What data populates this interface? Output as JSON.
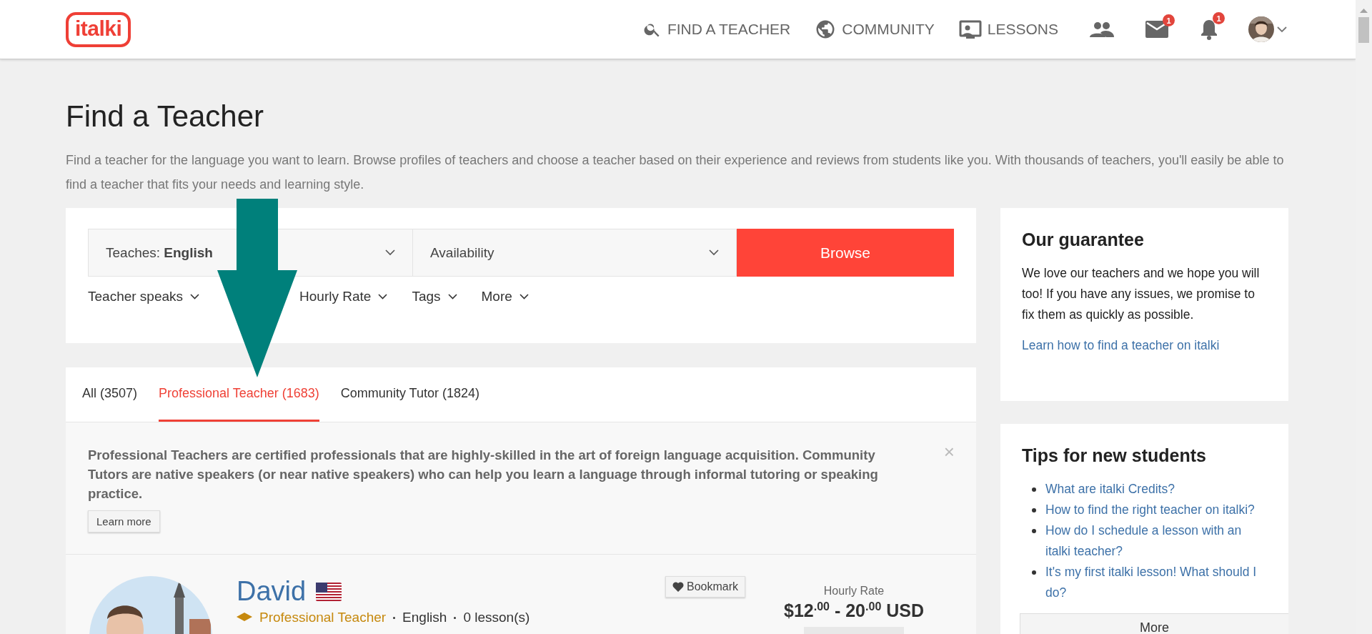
{
  "header": {
    "logo": "italki",
    "nav": [
      {
        "label": "FIND A TEACHER",
        "kind": "search"
      },
      {
        "label": "COMMUNITY",
        "kind": "globe"
      },
      {
        "label": "LESSONS",
        "kind": "lessons"
      }
    ],
    "icons": [
      {
        "kind": "people"
      },
      {
        "kind": "mail",
        "badge": "1"
      },
      {
        "kind": "bell",
        "badge": "1"
      }
    ]
  },
  "page": {
    "title": "Find a Teacher",
    "description": "Find a teacher for the language you want to learn. Browse profiles of teachers and choose a teacher based on their experience and reviews from students like you. With thousands of teachers, you'll easily be able to find a teacher that fits your needs and learning style."
  },
  "search": {
    "teaches": "Teaches: **English**",
    "availability": "Availability",
    "browse": "Browse",
    "filters": [
      "Teacher speaks",
      "Hourly Rate",
      "Tags",
      "More"
    ]
  },
  "tabs": [
    {
      "label": "All (3507)",
      "selected": false
    },
    {
      "label": "Professional Teacher (1683)",
      "selected": true
    },
    {
      "label": "Community Tutor (1824)",
      "selected": false
    }
  ],
  "notice": {
    "text": "Professional Teachers are certified professionals that are highly-skilled in the art of foreign language acquisition. Community Tutors are native speakers (or near native speakers) who can help you learn a language through informal tutoring or speaking practice.",
    "button": "Learn more",
    "close": "×"
  },
  "teacher": {
    "name": "David",
    "bookmark": "Bookmark",
    "rate_label": "Hourly Rate",
    "price": "$12$^{.00}$ - 20$^{.00}$ USD",
    "badge": "Professional Teacher",
    "language": "English",
    "lessons": "0 lesson(s)"
  },
  "guarantee": {
    "title": "Our guarantee",
    "text": "We love our teachers and we hope you will too! If you have any issues, we promise to fix them as quickly as possible.",
    "link": "Learn how to find a teacher on italki"
  },
  "tips": {
    "title": "Tips for new students",
    "links": [
      "What are italki Credits?",
      "How to find the right teacher on italki?",
      "How do I schedule a lesson with an italki teacher?",
      "It's my first italki lesson! What should I do?"
    ],
    "more": "More"
  }
}
